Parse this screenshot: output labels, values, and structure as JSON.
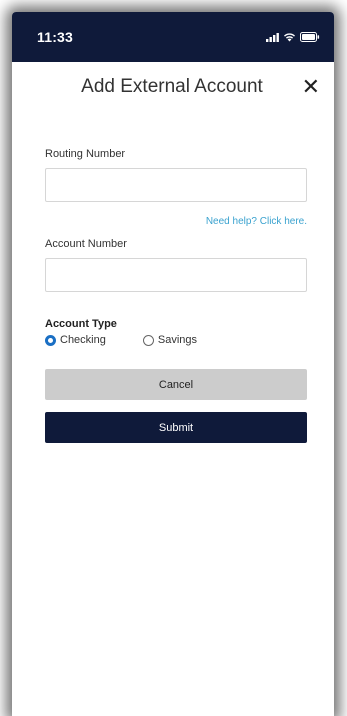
{
  "status_bar": {
    "time": "11:33",
    "icons": [
      "signal-icon",
      "wifi-icon",
      "battery-icon"
    ],
    "background": "#0f1a3a"
  },
  "header": {
    "title": "Add External Account",
    "close_glyph": "✕"
  },
  "form": {
    "routing": {
      "label": "Routing Number",
      "value": "",
      "placeholder": ""
    },
    "help_link": "Need help? Click here.",
    "account": {
      "label": "Account Number",
      "value": "",
      "placeholder": ""
    },
    "account_type": {
      "label": "Account Type",
      "options": [
        {
          "label": "Checking",
          "selected": true
        },
        {
          "label": "Savings",
          "selected": false
        }
      ]
    }
  },
  "buttons": {
    "cancel_label": "Cancel",
    "submit_label": "Submit"
  },
  "colors": {
    "primary": "#0f1a3a",
    "link": "#3aa2cf",
    "radio_selected": "#1a6fc4",
    "cancel_bg": "#cccccc"
  }
}
